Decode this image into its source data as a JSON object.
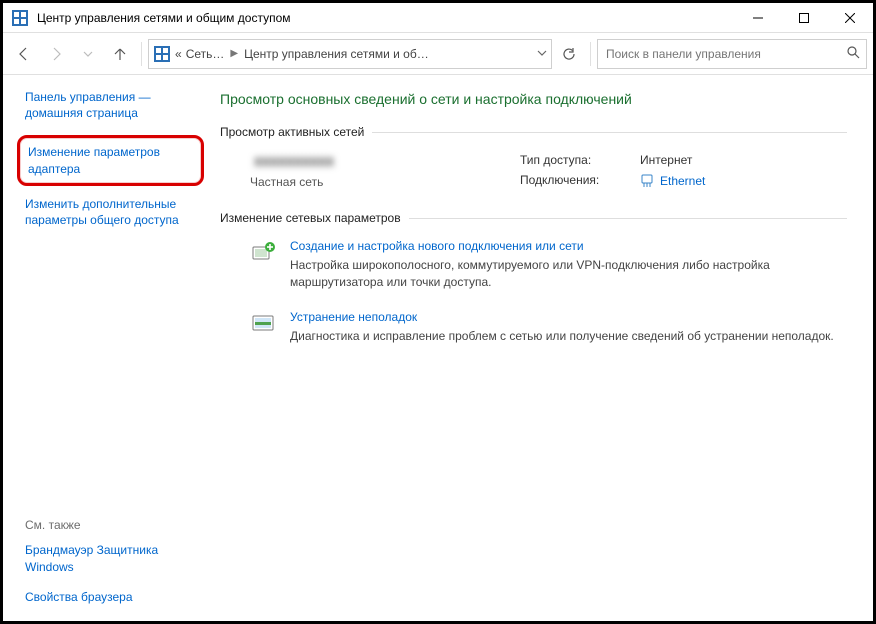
{
  "window": {
    "title": "Центр управления сетями и общим доступом"
  },
  "toolbar": {
    "crumb_root_glyph": "«",
    "crumb1": "Сеть…",
    "crumb2": "Центр управления сетями и об…",
    "search_placeholder": "Поиск в панели управления"
  },
  "sidebar": {
    "home": "Панель управления — домашняя страница",
    "adapter": "Изменение параметров адаптера",
    "advanced": "Изменить дополнительные параметры общего доступа",
    "see_also": "См. также",
    "firewall": "Брандмауэр Защитника Windows",
    "browser": "Свойства браузера"
  },
  "main": {
    "heading": "Просмотр основных сведений о сети и настройка подключений",
    "active_group": "Просмотр активных сетей",
    "network_name": "XXXXXXXXXX",
    "network_kind": "Частная сеть",
    "access_label": "Тип доступа:",
    "access_value": "Интернет",
    "conn_label": "Подключения:",
    "conn_value": "Ethernet",
    "change_group": "Изменение сетевых параметров",
    "task1_title": "Создание и настройка нового подключения или сети",
    "task1_desc": "Настройка широкополосного, коммутируемого или VPN-подключения либо настройка маршрутизатора или точки доступа.",
    "task2_title": "Устранение неполадок",
    "task2_desc": "Диагностика и исправление проблем с сетью или получение сведений об устранении неполадок."
  }
}
